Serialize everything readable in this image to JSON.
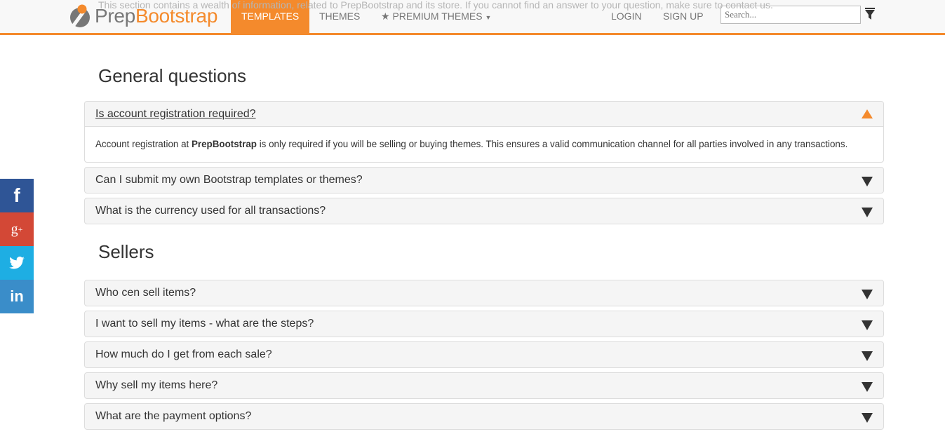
{
  "intro_text_behind_nav": "This section contains a wealth of information, related to PrepBootstrap and its store. If you cannot find an answer to your question, make sure to contact us.",
  "nav": {
    "logo": {
      "part1": "Prep",
      "part2": "Bootstrap"
    },
    "items": [
      {
        "label": "TEMPLATES",
        "active": true
      },
      {
        "label": "THEMES"
      },
      {
        "label": "PREMIUM THEMES",
        "icon": "star-icon",
        "dropdown": true
      },
      {
        "label": "LOGIN"
      },
      {
        "label": "SIGN UP"
      }
    ],
    "search_placeholder": "Search...",
    "filter_icon": "filter-icon"
  },
  "colors": {
    "accent": "#f48a2c",
    "facebook": "#2f5596",
    "googleplus": "#d34836",
    "twitter": "#1eaee3",
    "linkedin": "#3a8dc9"
  },
  "social": [
    {
      "name": "facebook",
      "glyph": "f"
    },
    {
      "name": "google-plus",
      "glyph": "g+"
    },
    {
      "name": "twitter",
      "glyph": "twitter-bird"
    },
    {
      "name": "linkedin",
      "glyph": "in"
    }
  ],
  "sections": [
    {
      "title": "General questions",
      "items": [
        {
          "question": "Is account registration required?",
          "open": true,
          "answer_pre": "Account registration at ",
          "answer_bold": "PrepBootstrap",
          "answer_post": " is only required if you will be selling or buying themes. This ensures a valid communication channel for all parties involved in any transactions."
        },
        {
          "question": "Can I submit my own Bootstrap templates or themes?"
        },
        {
          "question": "What is the currency used for all transactions?"
        }
      ]
    },
    {
      "title": "Sellers",
      "items": [
        {
          "question": "Who cen sell items?"
        },
        {
          "question": "I want to sell my items - what are the steps?"
        },
        {
          "question": "How much do I get from each sale?"
        },
        {
          "question": "Why sell my items here?"
        },
        {
          "question": "What are the payment options?"
        }
      ]
    }
  ]
}
